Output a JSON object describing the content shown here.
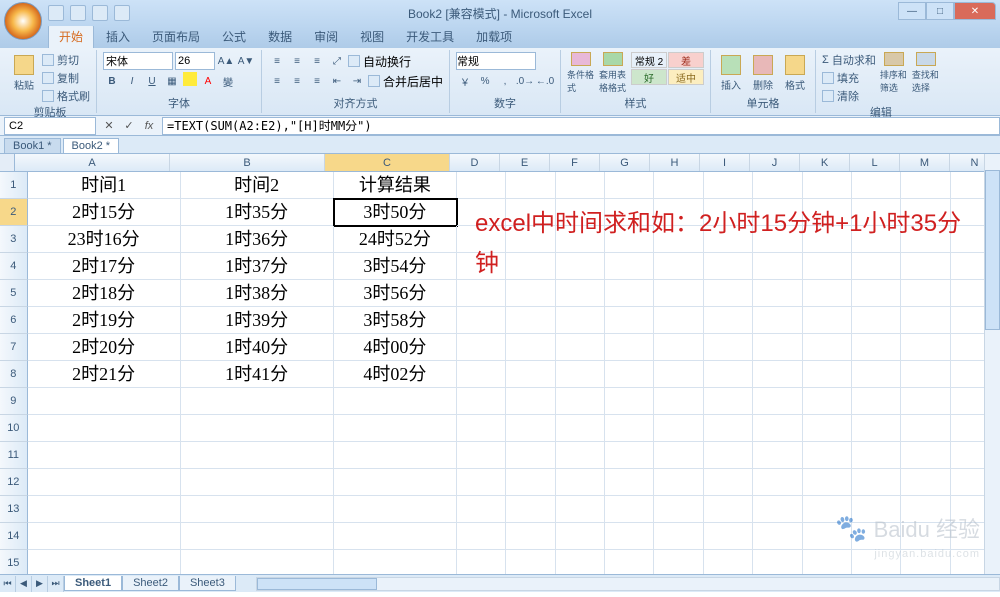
{
  "title": "Book2 [兼容模式] - Microsoft Excel",
  "ribbon_tabs": [
    "开始",
    "插入",
    "页面布局",
    "公式",
    "数据",
    "审阅",
    "视图",
    "开发工具",
    "加载项"
  ],
  "active_tab_index": 0,
  "clipboard": {
    "label": "剪贴板",
    "paste": "粘贴",
    "cut": "剪切",
    "copy": "复制",
    "brush": "格式刷"
  },
  "font": {
    "label": "字体",
    "name": "宋体",
    "size": "26",
    "bold": "B",
    "italic": "I",
    "underline": "U"
  },
  "align": {
    "label": "对齐方式",
    "wrap": "自动换行",
    "merge": "合并后居中"
  },
  "number": {
    "label": "数字",
    "format": "常规"
  },
  "styles": {
    "label": "样式",
    "condfmt": "条件格式",
    "tableformat": "套用表格格式",
    "bad": "差",
    "good": "好",
    "normal": "常规 2",
    "mid": "适中"
  },
  "cells": {
    "label": "单元格",
    "insert": "插入",
    "delete": "删除",
    "format": "格式"
  },
  "editing": {
    "label": "编辑",
    "autosum": "自动求和",
    "fill": "填充",
    "clear": "清除",
    "sort": "排序和筛选",
    "find": "查找和选择"
  },
  "name_box": "C2",
  "formula": "=TEXT(SUM(A2:E2),\"[H]时MM分\")",
  "workbook_tabs": [
    "Book1",
    "Book2"
  ],
  "active_workbook_index": 1,
  "columns": [
    "A",
    "B",
    "C",
    "D",
    "E",
    "F",
    "G",
    "H",
    "I",
    "J",
    "K",
    "L",
    "M",
    "N"
  ],
  "col_widths": [
    "col-A",
    "col-B",
    "col-C",
    "col-D",
    "col-E",
    "col-F",
    "col-G",
    "col-H",
    "col-I",
    "col-J",
    "col-K",
    "col-L",
    "col-M",
    "col-N"
  ],
  "selected_cell": {
    "row": 2,
    "col": 2
  },
  "data_rows": [
    [
      "时间1",
      "时间2",
      "计算结果"
    ],
    [
      "2时15分",
      "1时35分",
      "3时50分"
    ],
    [
      "23时16分",
      "1时36分",
      "24时52分"
    ],
    [
      "2时17分",
      "1时37分",
      "3时54分"
    ],
    [
      "2时18分",
      "1时38分",
      "3时56分"
    ],
    [
      "2时19分",
      "1时39分",
      "3时58分"
    ],
    [
      "2时20分",
      "1时40分",
      "4时00分"
    ],
    [
      "2时21分",
      "1时41分",
      "4时02分"
    ]
  ],
  "total_visible_rows": 15,
  "overlay": "excel中时间求和如：2小时15分钟+1小时35分钟",
  "sheet_tabs": [
    "Sheet1",
    "Sheet2",
    "Sheet3"
  ],
  "active_sheet_index": 0,
  "watermark": "Baidu 经验",
  "watermark_sub": "jingyan.baidu.com"
}
